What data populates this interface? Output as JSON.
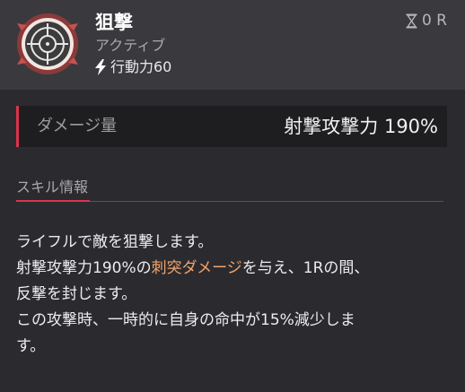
{
  "skill": {
    "name": "狙撃",
    "type": "アクティブ",
    "action_point_label": "行動力60",
    "cooldown": "0 R",
    "icon": "crosshair-icon"
  },
  "damage": {
    "label": "ダメージ量",
    "value": "射撃攻撃力 190%"
  },
  "section": {
    "title": "スキル情報"
  },
  "description": {
    "line1": "ライフルで敵を狙撃します。",
    "line2_before": "射撃攻撃力190%の",
    "line2_highlight": "刺突ダメージ",
    "line2_after": "を与え、1Rの間、",
    "line3": "反撃を封じます。",
    "line4": "この攻撃時、一時的に自身の命中が15%減少しま",
    "line5": "す。"
  },
  "colors": {
    "accent": "#d9344e",
    "highlight": "#f3a36b",
    "background": "#2b2b2f",
    "header_background": "#3a3a3e"
  }
}
